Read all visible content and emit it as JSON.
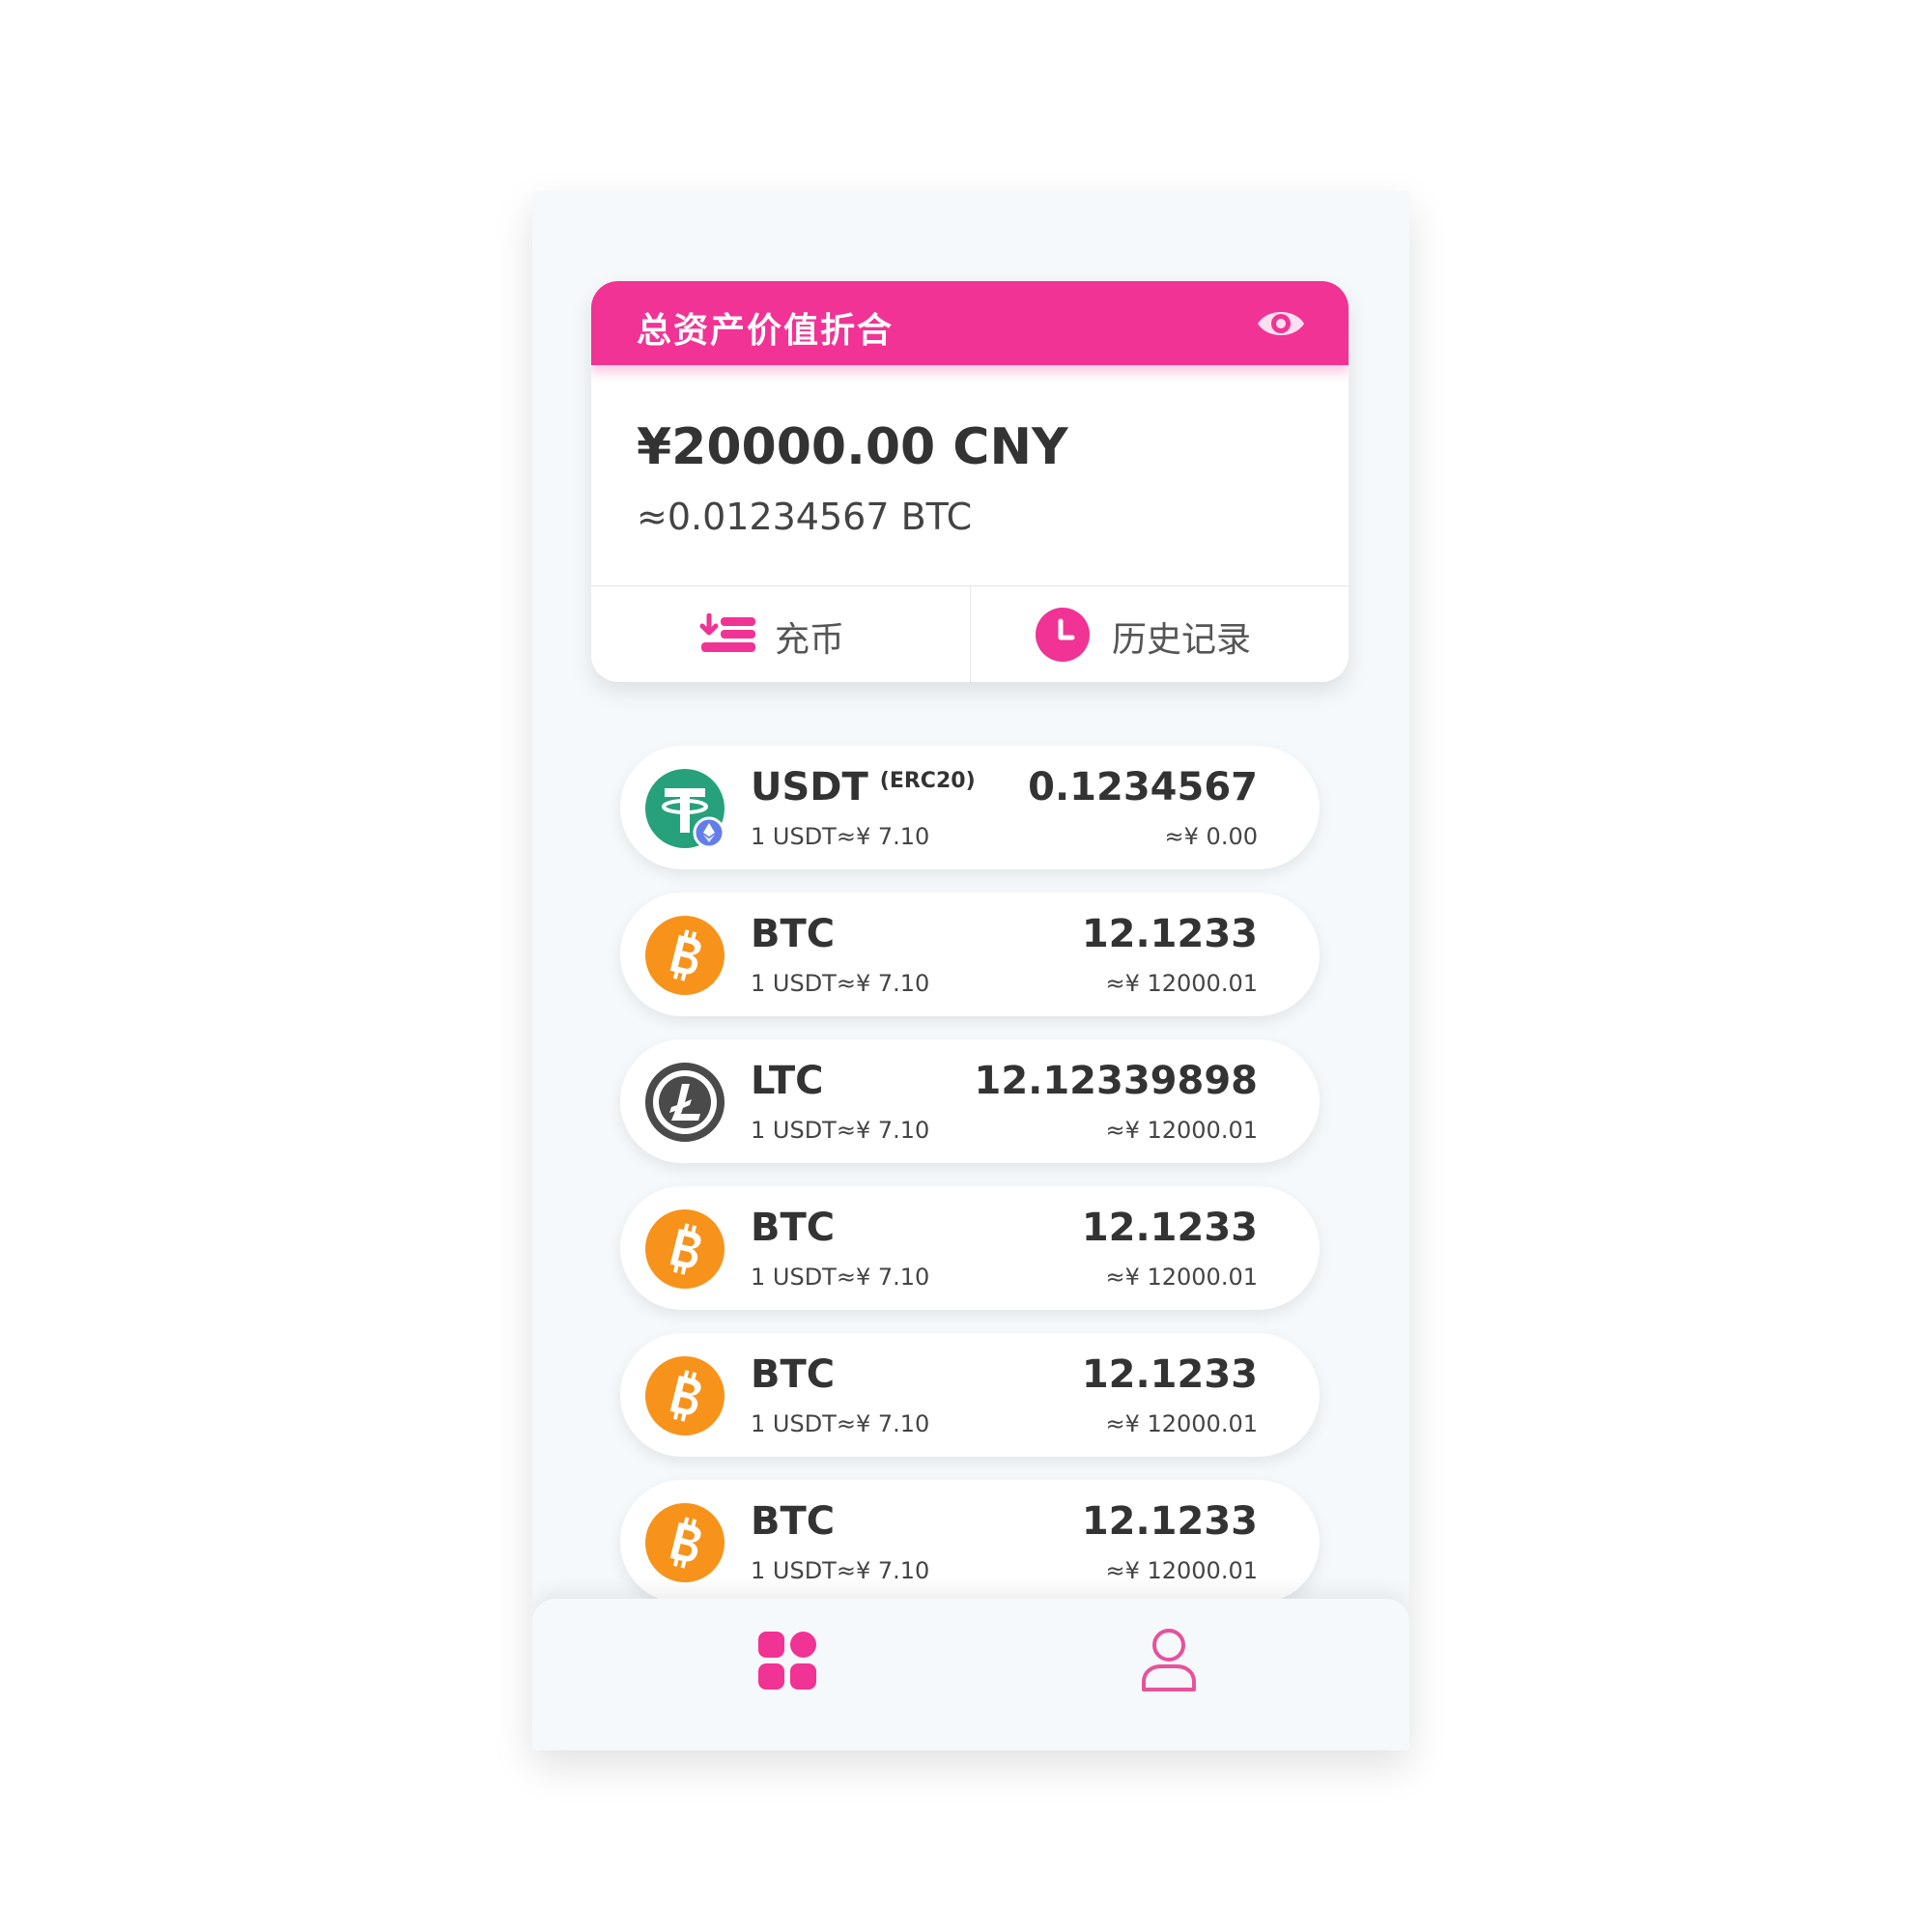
{
  "summary": {
    "title": "总资产价值折合",
    "total_cny": "¥20000.00 CNY",
    "total_btc": "≈0.01234567 BTC",
    "eye_icon": "eye-icon",
    "actions": [
      {
        "label": "充币",
        "icon": "deposit-icon"
      },
      {
        "label": "历史记录",
        "icon": "clock-icon"
      }
    ]
  },
  "coins": [
    {
      "name": "USDT",
      "network": "(ERC20)",
      "rate": "1 USDT≈¥ 7.10",
      "amount": "0.1234567",
      "value": "≈¥ 0.00",
      "icon": "tether-icon"
    },
    {
      "name": "BTC",
      "network": "",
      "rate": "1 USDT≈¥ 7.10",
      "amount": "12.1233",
      "value": "≈¥ 12000.01",
      "icon": "bitcoin-icon"
    },
    {
      "name": "LTC",
      "network": "",
      "rate": "1 USDT≈¥ 7.10",
      "amount": "12.12339898",
      "value": "≈¥ 12000.01",
      "icon": "litecoin-icon"
    },
    {
      "name": "BTC",
      "network": "",
      "rate": "1 USDT≈¥ 7.10",
      "amount": "12.1233",
      "value": "≈¥ 12000.01",
      "icon": "bitcoin-icon"
    },
    {
      "name": "BTC",
      "network": "",
      "rate": "1 USDT≈¥ 7.10",
      "amount": "12.1233",
      "value": "≈¥ 12000.01",
      "icon": "bitcoin-icon"
    },
    {
      "name": "BTC",
      "network": "",
      "rate": "1 USDT≈¥ 7.10",
      "amount": "12.1233",
      "value": "≈¥ 12000.01",
      "icon": "bitcoin-icon"
    }
  ],
  "tabbar": [
    {
      "icon": "grid-icon"
    },
    {
      "icon": "user-icon"
    }
  ],
  "colors": {
    "accent": "#f03394",
    "tether": "#26a17b",
    "ethereum": "#627eea",
    "bitcoin": "#f7931a",
    "litecoin": "#4a4a4a",
    "background": "#f5f9fb"
  }
}
